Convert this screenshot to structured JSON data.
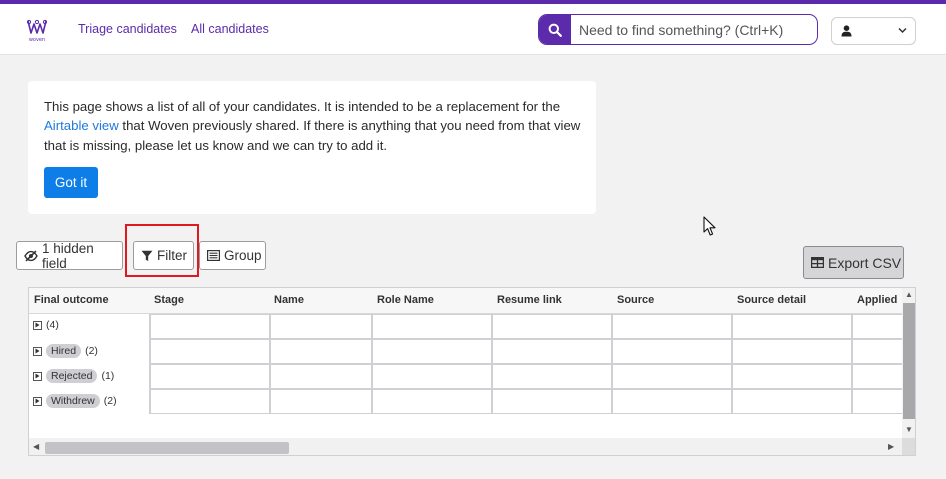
{
  "brand": {
    "logo_text": "woven",
    "accent_color": "#5b2bab"
  },
  "nav": {
    "links": [
      {
        "label": "Triage candidates"
      },
      {
        "label": "All candidates"
      }
    ],
    "search": {
      "placeholder": "Need to find something? (Ctrl+K)",
      "icon": "search-icon"
    },
    "user_menu": {
      "icon": "user-icon",
      "chevron": "chevron-down-icon"
    }
  },
  "notice": {
    "text_before": "This page shows a list of all of your candidates. It is intended to be a replacement for the ",
    "link_text": "Airtable view",
    "text_after": " that Woven previously shared. If there is anything that you need from that view that is missing, please let us know and we can try to add it.",
    "button_label": "Got it"
  },
  "toolbar": {
    "hidden_fields_label": "1 hidden field",
    "filter_label": "Filter",
    "group_label": "Group",
    "export_label": "Export CSV"
  },
  "table": {
    "columns": [
      "Final outcome",
      "Stage",
      "Name",
      "Role Name",
      "Resume link",
      "Source",
      "Source detail",
      "Applied"
    ],
    "groups": [
      {
        "label": "",
        "count": "(4)"
      },
      {
        "label": "Hired",
        "count": "(2)"
      },
      {
        "label": "Rejected",
        "count": "(1)"
      },
      {
        "label": "Withdrew",
        "count": "(2)"
      }
    ]
  }
}
